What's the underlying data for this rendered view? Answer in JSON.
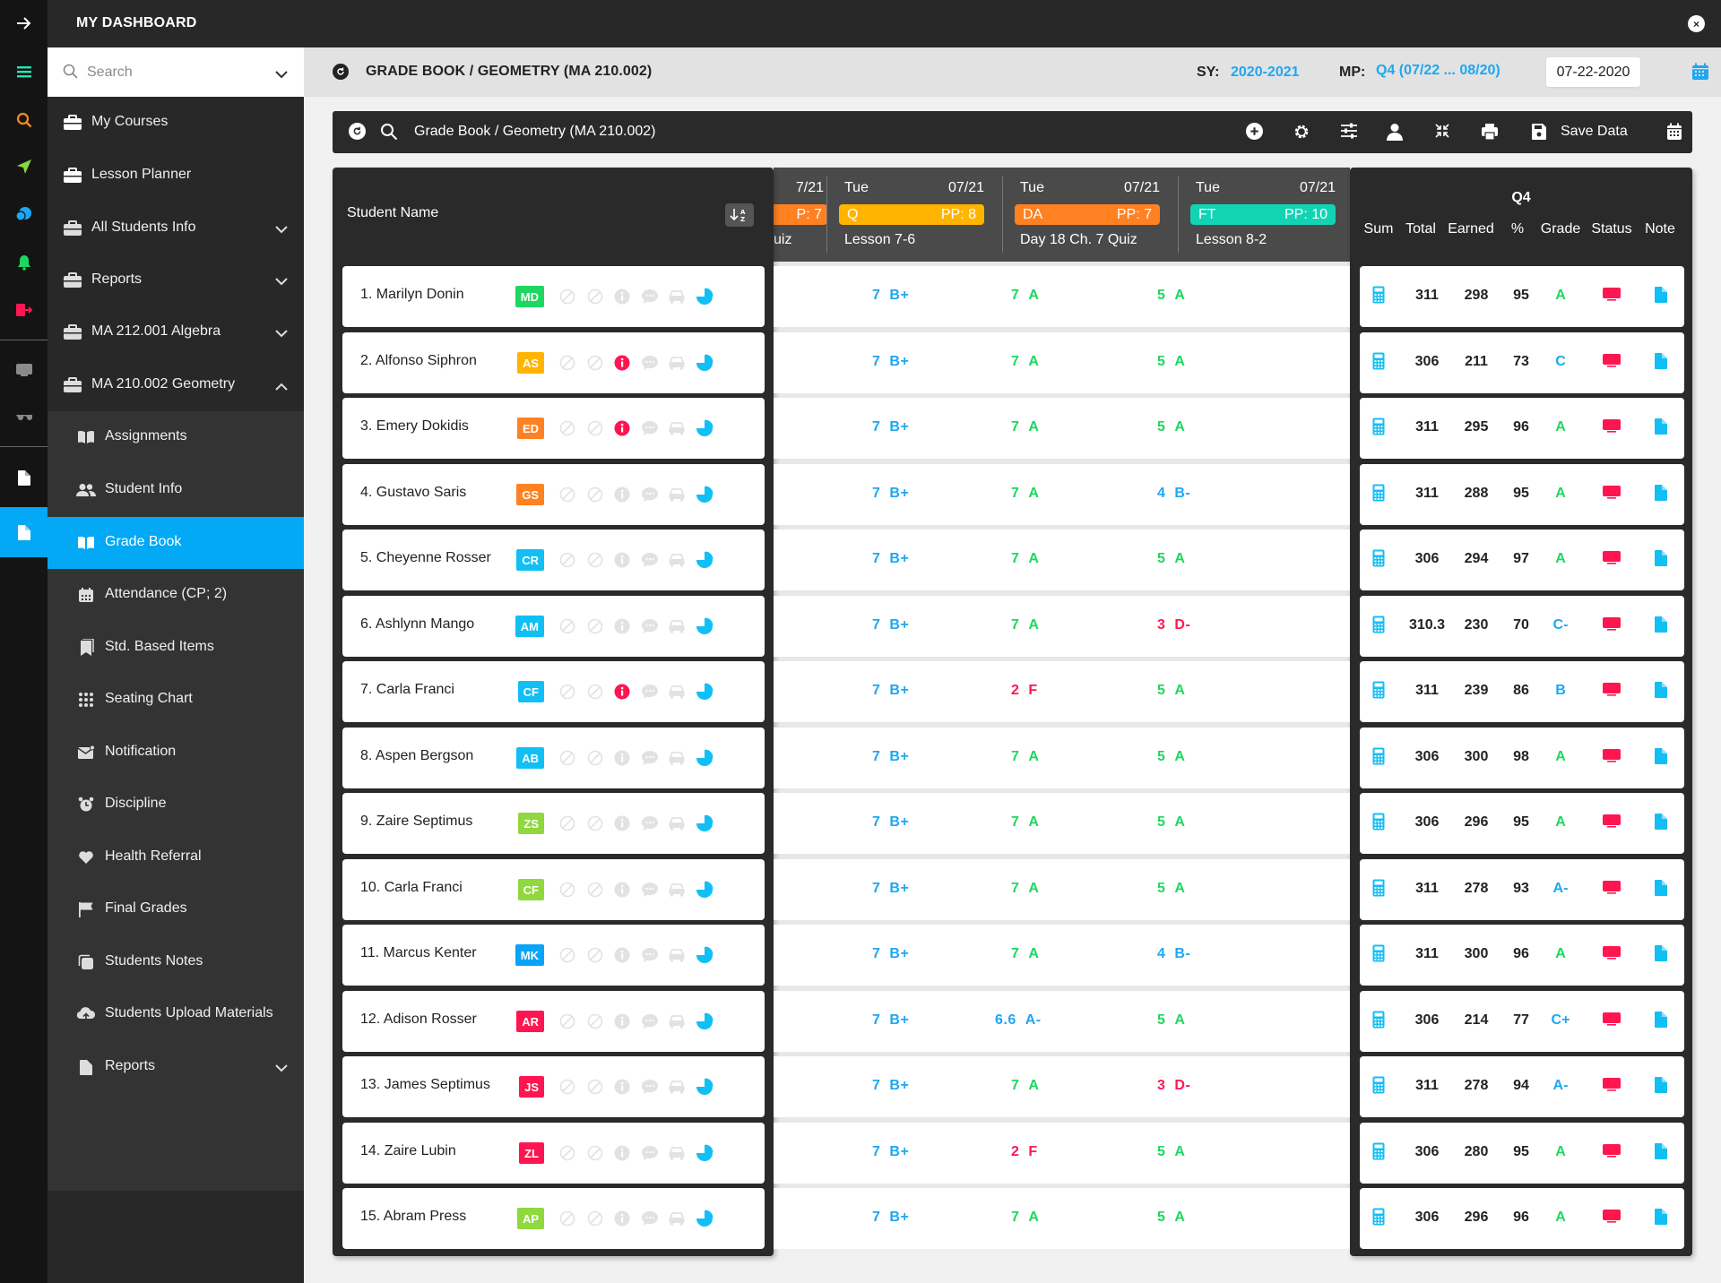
{
  "app": {
    "title": "MY DASHBOARD",
    "close_icon": "close-icon"
  },
  "rail": {
    "icons": [
      "arrow-right-icon",
      "menu-icon",
      "search-icon",
      "navigation-icon",
      "chat-icon",
      "bell-icon",
      "logout-icon",
      "monitor-icon",
      "glasses-icon",
      "document-icon",
      "document-active-icon"
    ],
    "colors": {
      "menu": "#1de9b6",
      "search": "#ff8a1e",
      "navigation": "#8bd63b",
      "chat": "#1ea7f2",
      "bell": "#1ed760",
      "logout": "#ff1650"
    }
  },
  "sidebar": {
    "search": {
      "placeholder": "Search",
      "value": ""
    },
    "items": [
      {
        "label": "My Courses",
        "icon": "briefcase-icon",
        "chevron": ""
      },
      {
        "label": "Lesson Planner",
        "icon": "briefcase-icon",
        "chevron": ""
      },
      {
        "label": "All Students Info",
        "icon": "briefcase-icon",
        "chevron": "down"
      },
      {
        "label": "Reports",
        "icon": "briefcase-icon",
        "chevron": "down"
      },
      {
        "label": "MA 212.001 Algebra",
        "icon": "briefcase-icon",
        "chevron": "down"
      },
      {
        "label": "MA 210.002 Geometry",
        "icon": "briefcase-icon",
        "chevron": "up"
      }
    ],
    "sub_items": [
      {
        "label": "Assignments",
        "icon": "book-icon"
      },
      {
        "label": "Student Info",
        "icon": "users-icon"
      },
      {
        "label": "Grade Book",
        "icon": "book-icon",
        "active": true
      },
      {
        "label": "Attendance (CP; 2)",
        "icon": "calendar-icon"
      },
      {
        "label": "Std. Based Items",
        "icon": "bookmark-icon"
      },
      {
        "label": "Seating Chart",
        "icon": "grid-dots-icon"
      },
      {
        "label": "Notification",
        "icon": "mail-icon"
      },
      {
        "label": "Discipline",
        "icon": "alarm-clock-icon"
      },
      {
        "label": "Health Referral",
        "icon": "heart-icon"
      },
      {
        "label": "Final Grades",
        "icon": "flag-icon"
      },
      {
        "label": "Students Notes",
        "icon": "notes-icon"
      },
      {
        "label": "Students Upload Materials",
        "icon": "cloud-upload-icon"
      },
      {
        "label": "Reports",
        "icon": "file-icon",
        "chevron": "down"
      }
    ]
  },
  "header": {
    "title": "GRADE BOOK / GEOMETRY (MA 210.002)",
    "sy_label": "SY:",
    "sy_value": "2020-2021",
    "mp_label": "MP:",
    "mp_value": "Q4 (07/22 ... 08/20)",
    "date": "07-22-2020"
  },
  "toolbar": {
    "title": "Grade Book / Geometry (MA 210.002)",
    "save_label": "Save Data",
    "icons": [
      "add-icon",
      "settings-icon",
      "sliders-icon",
      "user-icon",
      "collapse-icon",
      "print-icon",
      "save-icon",
      "calendar-icon"
    ]
  },
  "table": {
    "student_name_header": "Student Name",
    "sort_label": "↓A-Z",
    "partial_column": {
      "date": "7/21",
      "pp": "P: 7",
      "desc": "uiz",
      "color": "#ff8122"
    },
    "columns": [
      {
        "day": "Tue",
        "date": "07/21",
        "type": "Q",
        "pp": "PP: 8",
        "desc": "Lesson 7-6",
        "color": "#ffb400"
      },
      {
        "day": "Tue",
        "date": "07/21",
        "type": "DA",
        "pp": "PP: 7",
        "desc": "Day 18 Ch. 7 Quiz",
        "color": "#ff8122"
      },
      {
        "day": "Tue",
        "date": "07/21",
        "type": "FT",
        "pp": "PP: 10",
        "desc": "Lesson 8-2",
        "color": "#12d4b4"
      }
    ],
    "summary": {
      "period": "Q4",
      "headers": [
        "Sum",
        "Total",
        "Earned",
        "%",
        "Grade",
        "Status",
        "Note"
      ]
    },
    "grade_colors": {
      "good": "#1ed760",
      "mid": "#1ea7f2",
      "bad": "#ff1650"
    },
    "rows": [
      {
        "name": "1. Marilyn Donin",
        "initials": "MD",
        "badge_color": "#1ed760",
        "info_alert": false,
        "scores": [
          [
            "7",
            "B+",
            "mid"
          ],
          [
            "7",
            "A",
            "good"
          ],
          [
            "5",
            "A",
            "good"
          ]
        ],
        "total": "311",
        "earned": "298",
        "pct": "95",
        "grade": "A",
        "grade_tone": "good"
      },
      {
        "name": "2. Alfonso Siphron",
        "initials": "AS",
        "badge_color": "#ffb400",
        "info_alert": true,
        "scores": [
          [
            "7",
            "B+",
            "mid"
          ],
          [
            "7",
            "A",
            "good"
          ],
          [
            "5",
            "A",
            "good"
          ]
        ],
        "total": "306",
        "earned": "211",
        "pct": "73",
        "grade": "C",
        "grade_tone": "mid"
      },
      {
        "name": "3. Emery Dokidis",
        "initials": "ED",
        "badge_color": "#ff8122",
        "info_alert": true,
        "scores": [
          [
            "7",
            "B+",
            "mid"
          ],
          [
            "7",
            "A",
            "good"
          ],
          [
            "5",
            "A",
            "good"
          ]
        ],
        "total": "311",
        "earned": "295",
        "pct": "96",
        "grade": "A",
        "grade_tone": "good"
      },
      {
        "name": "4. Gustavo Saris",
        "initials": "GS",
        "badge_color": "#ff8122",
        "info_alert": false,
        "scores": [
          [
            "7",
            "B+",
            "mid"
          ],
          [
            "7",
            "A",
            "good"
          ],
          [
            "4",
            "B-",
            "mid"
          ]
        ],
        "total": "311",
        "earned": "288",
        "pct": "95",
        "grade": "A",
        "grade_tone": "good"
      },
      {
        "name": "5. Cheyenne Rosser",
        "initials": "CR",
        "badge_color": "#12bff5",
        "info_alert": false,
        "scores": [
          [
            "7",
            "B+",
            "mid"
          ],
          [
            "7",
            "A",
            "good"
          ],
          [
            "5",
            "A",
            "good"
          ]
        ],
        "total": "306",
        "earned": "294",
        "pct": "97",
        "grade": "A",
        "grade_tone": "good"
      },
      {
        "name": "6. Ashlynn Mango",
        "initials": "AM",
        "badge_color": "#12bff5",
        "info_alert": false,
        "scores": [
          [
            "7",
            "B+",
            "mid"
          ],
          [
            "7",
            "A",
            "good"
          ],
          [
            "3",
            "D-",
            "bad"
          ]
        ],
        "total": "310.3",
        "earned": "230",
        "pct": "70",
        "grade": "C-",
        "grade_tone": "mid"
      },
      {
        "name": "7. Carla Franci",
        "initials": "CF",
        "badge_color": "#12bff5",
        "info_alert": true,
        "scores": [
          [
            "7",
            "B+",
            "mid"
          ],
          [
            "2",
            "F",
            "bad"
          ],
          [
            "5",
            "A",
            "good"
          ]
        ],
        "total": "311",
        "earned": "239",
        "pct": "86",
        "grade": "B",
        "grade_tone": "mid"
      },
      {
        "name": "8. Aspen Bergson",
        "initials": "AB",
        "badge_color": "#12bff5",
        "info_alert": false,
        "scores": [
          [
            "7",
            "B+",
            "mid"
          ],
          [
            "7",
            "A",
            "good"
          ],
          [
            "5",
            "A",
            "good"
          ]
        ],
        "total": "306",
        "earned": "300",
        "pct": "98",
        "grade": "A",
        "grade_tone": "good"
      },
      {
        "name": "9. Zaire Septimus",
        "initials": "ZS",
        "badge_color": "#8fd83e",
        "info_alert": false,
        "scores": [
          [
            "7",
            "B+",
            "mid"
          ],
          [
            "7",
            "A",
            "good"
          ],
          [
            "5",
            "A",
            "good"
          ]
        ],
        "total": "306",
        "earned": "296",
        "pct": "95",
        "grade": "A",
        "grade_tone": "good"
      },
      {
        "name": "10. Carla Franci",
        "initials": "CF",
        "badge_color": "#8fd83e",
        "info_alert": false,
        "scores": [
          [
            "7",
            "B+",
            "mid"
          ],
          [
            "7",
            "A",
            "good"
          ],
          [
            "5",
            "A",
            "good"
          ]
        ],
        "total": "311",
        "earned": "278",
        "pct": "93",
        "grade": "A-",
        "grade_tone": "mid"
      },
      {
        "name": "11. Marcus Kenter",
        "initials": "MK",
        "badge_color": "#0aa4f6",
        "info_alert": false,
        "scores": [
          [
            "7",
            "B+",
            "mid"
          ],
          [
            "7",
            "A",
            "good"
          ],
          [
            "4",
            "B-",
            "mid"
          ]
        ],
        "total": "311",
        "earned": "300",
        "pct": "96",
        "grade": "A",
        "grade_tone": "good"
      },
      {
        "name": "12. Adison Rosser",
        "initials": "AR",
        "badge_color": "#ff1650",
        "info_alert": false,
        "scores": [
          [
            "7",
            "B+",
            "mid"
          ],
          [
            "6.6",
            "A-",
            "mid"
          ],
          [
            "5",
            "A",
            "good"
          ]
        ],
        "total": "306",
        "earned": "214",
        "pct": "77",
        "grade": "C+",
        "grade_tone": "mid"
      },
      {
        "name": "13. James Septimus",
        "initials": "JS",
        "badge_color": "#ff1650",
        "info_alert": false,
        "scores": [
          [
            "7",
            "B+",
            "mid"
          ],
          [
            "7",
            "A",
            "good"
          ],
          [
            "3",
            "D-",
            "bad"
          ]
        ],
        "total": "311",
        "earned": "278",
        "pct": "94",
        "grade": "A-",
        "grade_tone": "mid"
      },
      {
        "name": "14. Zaire Lubin",
        "initials": "ZL",
        "badge_color": "#ff1650",
        "info_alert": false,
        "scores": [
          [
            "7",
            "B+",
            "mid"
          ],
          [
            "2",
            "F",
            "bad"
          ],
          [
            "5",
            "A",
            "good"
          ]
        ],
        "total": "306",
        "earned": "280",
        "pct": "95",
        "grade": "A",
        "grade_tone": "good"
      },
      {
        "name": "15. Abram Press",
        "initials": "AP",
        "badge_color": "#8fd83e",
        "info_alert": false,
        "scores": [
          [
            "7",
            "B+",
            "mid"
          ],
          [
            "7",
            "A",
            "good"
          ],
          [
            "5",
            "A",
            "good"
          ]
        ],
        "total": "306",
        "earned": "296",
        "pct": "96",
        "grade": "A",
        "grade_tone": "good"
      }
    ],
    "row_icons": [
      "no-entry-icon",
      "no-entry-icon",
      "info-icon",
      "chat-bubble-icon",
      "car-icon",
      "pie-chart-icon"
    ],
    "summary_icons": {
      "sum": "calculator-icon",
      "status": "monitor-icon",
      "note": "file-icon"
    },
    "status_color": "#ff1650",
    "accent_color": "#1ea7f2"
  }
}
